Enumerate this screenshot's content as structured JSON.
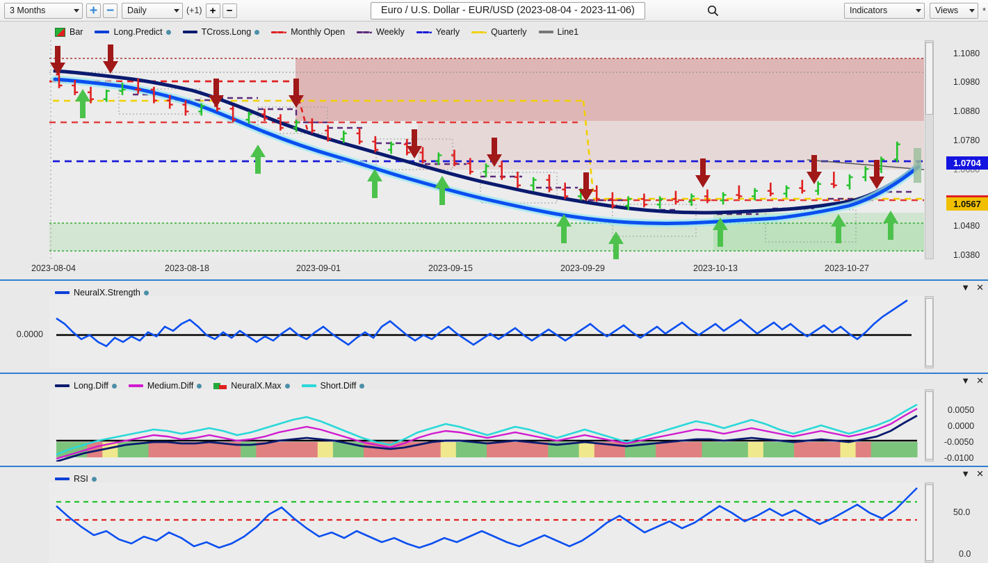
{
  "toolbar": {
    "range_select": "3 Months",
    "range_plus": "+",
    "range_minus": "−",
    "interval_select": "Daily",
    "interval_offset": "(+1)",
    "interval_plus": "+",
    "interval_minus": "−",
    "title": "Euro / U.S. Dollar - EUR/USD (2023-08-04 - 2023-11-06)",
    "search_icon": "search-icon",
    "indicators_select": "Indicators",
    "views_select": "Views",
    "star": "*"
  },
  "main_legend": [
    {
      "label": "Bar",
      "type": "bar",
      "color": "#22a83c"
    },
    {
      "label": "Long.Predict",
      "type": "line",
      "color": "#0a3fd8",
      "dot": true
    },
    {
      "label": "TCross.Long",
      "type": "line",
      "color": "#0a1a6e",
      "dot": true
    },
    {
      "label": "Monthly Open",
      "type": "dash",
      "color": "#e02020"
    },
    {
      "label": "Weekly",
      "type": "dash",
      "color": "#5a2a7a"
    },
    {
      "label": "Yearly",
      "type": "dash",
      "color": "#1a1ad8"
    },
    {
      "label": "Quarterly",
      "type": "dash",
      "color": "#f0d000"
    },
    {
      "label": "Line1",
      "type": "line",
      "color": "#777777"
    }
  ],
  "panels": [
    {
      "name": "neuralx-strength",
      "legend": [
        {
          "label": "NeuralX.Strength",
          "color": "#0a3fd8",
          "dot": true
        }
      ],
      "axis_left": [
        "0.0000"
      ],
      "axis_right": []
    },
    {
      "name": "diff-panel",
      "legend": [
        {
          "label": "Long.Diff",
          "color": "#0a1a6e",
          "dot": true
        },
        {
          "label": "Medium.Diff",
          "color": "#d01ad0",
          "dot": true
        },
        {
          "label": "NeuralX.Max",
          "color": "#22a83c",
          "dot": true,
          "type": "nx"
        },
        {
          "label": "Short.Diff",
          "color": "#2ad8d8",
          "dot": true
        }
      ],
      "axis_right": [
        "0.0050",
        "0.0000",
        "-0.0050",
        "-0.0100"
      ]
    },
    {
      "name": "rsi-panel",
      "legend": [
        {
          "label": "RSI",
          "color": "#0a3fd8",
          "dot": true
        }
      ],
      "axis_right": [
        "50.0",
        "0.0"
      ]
    }
  ],
  "price_axis": {
    "ticks": [
      "1.1080",
      "1.0980",
      "1.0880",
      "1.0780",
      "1.0680",
      "1.0480",
      "1.0380"
    ],
    "current_price_badge": "1.0704",
    "current_price_color": "#1414e0",
    "secondary_badge": "1.0567",
    "secondary_badge_color": "#f0c000"
  },
  "date_axis": [
    "2023-08-04",
    "2023-08-18",
    "2023-09-01",
    "2023-09-15",
    "2023-09-29",
    "2023-10-13",
    "2023-10-27"
  ],
  "panel_controls": {
    "collapse": "▼",
    "close": "✕"
  },
  "chart_data": {
    "type": "line",
    "title": "Euro / U.S. Dollar - EUR/USD (2023-08-04 - 2023-11-06)",
    "xlabel": "",
    "ylabel": "",
    "ylim": [
      1.033,
      1.113
    ],
    "xticks": [
      "2023-08-04",
      "2023-08-18",
      "2023-09-01",
      "2023-09-15",
      "2023-09-29",
      "2023-10-13",
      "2023-10-27"
    ],
    "yticks": [
      1.038,
      1.048,
      1.058,
      1.068,
      1.078,
      1.088,
      1.098,
      1.108
    ],
    "grid": false,
    "legend_position": "top",
    "ohlc": [
      {
        "o": 1.1005,
        "h": 1.104,
        "l": 1.0955,
        "c": 1.0965,
        "dir": "down"
      },
      {
        "o": 1.0965,
        "h": 1.0985,
        "l": 1.093,
        "c": 1.094,
        "dir": "down"
      },
      {
        "o": 1.094,
        "h": 1.096,
        "l": 1.09,
        "c": 1.0915,
        "dir": "down"
      },
      {
        "o": 1.0915,
        "h": 1.095,
        "l": 1.0905,
        "c": 1.0945,
        "dir": "up"
      },
      {
        "o": 1.0945,
        "h": 1.0975,
        "l": 1.093,
        "c": 1.095,
        "dir": "up"
      },
      {
        "o": 1.095,
        "h": 1.099,
        "l": 1.0935,
        "c": 1.095,
        "dir": "down"
      },
      {
        "o": 1.095,
        "h": 1.096,
        "l": 1.09,
        "c": 1.091,
        "dir": "down"
      },
      {
        "o": 1.091,
        "h": 1.093,
        "l": 1.088,
        "c": 1.0895,
        "dir": "down"
      },
      {
        "o": 1.0895,
        "h": 1.091,
        "l": 1.0855,
        "c": 1.087,
        "dir": "down"
      },
      {
        "o": 1.087,
        "h": 1.09,
        "l": 1.0855,
        "c": 1.089,
        "dir": "up"
      },
      {
        "o": 1.089,
        "h": 1.092,
        "l": 1.087,
        "c": 1.088,
        "dir": "down"
      },
      {
        "o": 1.088,
        "h": 1.089,
        "l": 1.083,
        "c": 1.084,
        "dir": "down"
      },
      {
        "o": 1.084,
        "h": 1.087,
        "l": 1.0825,
        "c": 1.086,
        "dir": "up"
      },
      {
        "o": 1.086,
        "h": 1.088,
        "l": 1.0835,
        "c": 1.0845,
        "dir": "down"
      },
      {
        "o": 1.0845,
        "h": 1.086,
        "l": 1.08,
        "c": 1.081,
        "dir": "down"
      },
      {
        "o": 1.081,
        "h": 1.084,
        "l": 1.0795,
        "c": 1.083,
        "dir": "up"
      },
      {
        "o": 1.083,
        "h": 1.0845,
        "l": 1.079,
        "c": 1.08,
        "dir": "down"
      },
      {
        "o": 1.08,
        "h": 1.082,
        "l": 1.076,
        "c": 1.077,
        "dir": "down"
      },
      {
        "o": 1.077,
        "h": 1.08,
        "l": 1.0755,
        "c": 1.079,
        "dir": "up"
      },
      {
        "o": 1.079,
        "h": 1.081,
        "l": 1.075,
        "c": 1.076,
        "dir": "down"
      },
      {
        "o": 1.076,
        "h": 1.078,
        "l": 1.072,
        "c": 1.073,
        "dir": "down"
      },
      {
        "o": 1.073,
        "h": 1.076,
        "l": 1.0715,
        "c": 1.075,
        "dir": "up"
      },
      {
        "o": 1.075,
        "h": 1.077,
        "l": 1.071,
        "c": 1.072,
        "dir": "down"
      },
      {
        "o": 1.072,
        "h": 1.074,
        "l": 1.068,
        "c": 1.069,
        "dir": "down"
      },
      {
        "o": 1.069,
        "h": 1.072,
        "l": 1.0675,
        "c": 1.071,
        "dir": "up"
      },
      {
        "o": 1.071,
        "h": 1.073,
        "l": 1.067,
        "c": 1.068,
        "dir": "down"
      },
      {
        "o": 1.068,
        "h": 1.07,
        "l": 1.064,
        "c": 1.065,
        "dir": "down"
      },
      {
        "o": 1.065,
        "h": 1.068,
        "l": 1.063,
        "c": 1.067,
        "dir": "up"
      },
      {
        "o": 1.067,
        "h": 1.069,
        "l": 1.062,
        "c": 1.063,
        "dir": "down"
      },
      {
        "o": 1.063,
        "h": 1.065,
        "l": 1.059,
        "c": 1.06,
        "dir": "down"
      },
      {
        "o": 1.06,
        "h": 1.063,
        "l": 1.058,
        "c": 1.062,
        "dir": "up"
      },
      {
        "o": 1.062,
        "h": 1.064,
        "l": 1.0575,
        "c": 1.0585,
        "dir": "down"
      },
      {
        "o": 1.0585,
        "h": 1.061,
        "l": 1.055,
        "c": 1.056,
        "dir": "down"
      },
      {
        "o": 1.056,
        "h": 1.059,
        "l": 1.0545,
        "c": 1.058,
        "dir": "up"
      },
      {
        "o": 1.058,
        "h": 1.06,
        "l": 1.054,
        "c": 1.055,
        "dir": "down"
      },
      {
        "o": 1.055,
        "h": 1.0575,
        "l": 1.0515,
        "c": 1.0525,
        "dir": "down"
      },
      {
        "o": 1.0525,
        "h": 1.056,
        "l": 1.051,
        "c": 1.055,
        "dir": "up"
      },
      {
        "o": 1.055,
        "h": 1.057,
        "l": 1.052,
        "c": 1.053,
        "dir": "down"
      },
      {
        "o": 1.053,
        "h": 1.056,
        "l": 1.0515,
        "c": 1.055,
        "dir": "up"
      },
      {
        "o": 1.055,
        "h": 1.058,
        "l": 1.053,
        "c": 1.054,
        "dir": "down"
      },
      {
        "o": 1.054,
        "h": 1.057,
        "l": 1.0525,
        "c": 1.056,
        "dir": "up"
      },
      {
        "o": 1.056,
        "h": 1.0585,
        "l": 1.0535,
        "c": 1.0545,
        "dir": "down"
      },
      {
        "o": 1.0545,
        "h": 1.0575,
        "l": 1.053,
        "c": 1.0565,
        "dir": "up"
      },
      {
        "o": 1.0565,
        "h": 1.06,
        "l": 1.055,
        "c": 1.056,
        "dir": "down"
      },
      {
        "o": 1.056,
        "h": 1.059,
        "l": 1.0545,
        "c": 1.058,
        "dir": "up"
      },
      {
        "o": 1.058,
        "h": 1.061,
        "l": 1.056,
        "c": 1.057,
        "dir": "down"
      },
      {
        "o": 1.057,
        "h": 1.06,
        "l": 1.0555,
        "c": 1.059,
        "dir": "up"
      },
      {
        "o": 1.059,
        "h": 1.062,
        "l": 1.057,
        "c": 1.058,
        "dir": "down"
      },
      {
        "o": 1.058,
        "h": 1.0615,
        "l": 1.0565,
        "c": 1.0605,
        "dir": "up"
      },
      {
        "o": 1.0605,
        "h": 1.065,
        "l": 1.059,
        "c": 1.06,
        "dir": "down"
      },
      {
        "o": 1.06,
        "h": 1.064,
        "l": 1.0585,
        "c": 1.063,
        "dir": "up"
      },
      {
        "o": 1.063,
        "h": 1.067,
        "l": 1.0615,
        "c": 1.066,
        "dir": "up"
      },
      {
        "o": 1.066,
        "h": 1.0705,
        "l": 1.0645,
        "c": 1.0695,
        "dir": "up"
      },
      {
        "o": 1.0695,
        "h": 1.076,
        "l": 1.0685,
        "c": 1.075,
        "dir": "up"
      }
    ],
    "reference_lines": [
      {
        "name": "Monthly Open",
        "value": 1.0965,
        "color": "#e02020",
        "style": "dashed"
      },
      {
        "name": "Yearly",
        "value": 1.0704,
        "color": "#1a1ad8",
        "style": "dashed"
      },
      {
        "name": "Quarterly",
        "value": 1.088,
        "color": "#f0d000",
        "style": "dashed"
      }
    ],
    "subpanels": [
      {
        "name": "NeuralX.Strength",
        "zero": 0.0,
        "ylim": [
          -1.2,
          1.6
        ]
      },
      {
        "name": "Diff",
        "ylim": [
          -0.0115,
          0.0075
        ],
        "yticks": [
          0.005,
          0.0,
          -0.005,
          -0.01
        ]
      },
      {
        "name": "RSI",
        "ylim": [
          0.0,
          100.0
        ],
        "yticks": [
          50.0,
          0.0
        ],
        "upper_band": 70.0,
        "lower_band": 30.0
      }
    ]
  }
}
